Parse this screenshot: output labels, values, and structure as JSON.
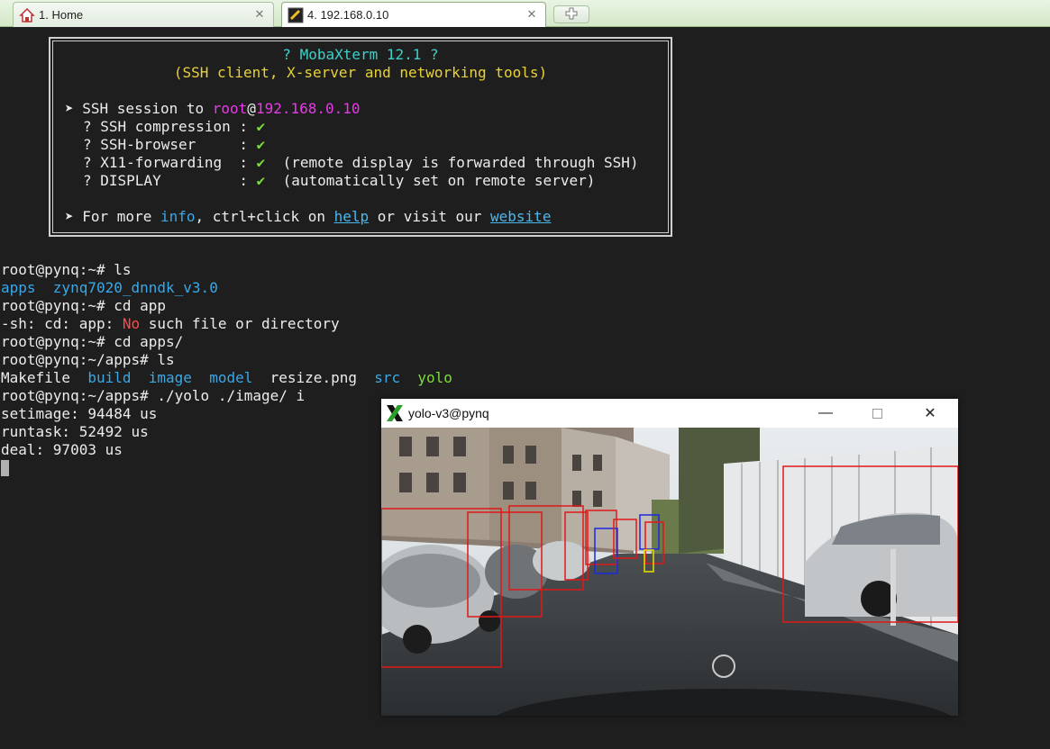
{
  "tabs": [
    {
      "label": "1. Home"
    },
    {
      "label": "4. 192.168.0.10"
    }
  ],
  "banner": {
    "title": "? MobaXterm 12.1 ?",
    "subtitle": "(SSH client, X-server and networking tools)",
    "session_prefix": "➤ SSH session to ",
    "session_user": "root",
    "session_at": "@",
    "session_host": "192.168.0.10",
    "features": [
      {
        "label": "? SSH compression : ",
        "check": "✔",
        "note": ""
      },
      {
        "label": "? SSH-browser     : ",
        "check": "✔",
        "note": ""
      },
      {
        "label": "? X11-forwarding  : ",
        "check": "✔",
        "note": "  (remote display is forwarded through SSH)"
      },
      {
        "label": "? DISPLAY         : ",
        "check": "✔",
        "note": "  (automatically set on remote server)"
      }
    ],
    "more_prefix": "➤ For more ",
    "more_info": "info",
    "more_mid": ", ctrl+click on ",
    "more_help": "help",
    "more_or": " or visit our ",
    "more_website": "website"
  },
  "terminal": {
    "l1": "root@pynq:~# ls",
    "l2_a": "apps",
    "l2_b": "zynq7020_dnndk_v3.0",
    "l3": "root@pynq:~# cd app",
    "l4_a": "-sh: cd: app: ",
    "l4_no": "No",
    "l4_b": " such file or directory",
    "l5": "root@pynq:~# cd apps/",
    "l6": "root@pynq:~/apps# ls",
    "l7_makefile": "Makefile",
    "l7_build": "build",
    "l7_image": "image",
    "l7_model": "model",
    "l7_resize": "resize.png",
    "l7_src": "src",
    "l7_yolo": "yolo",
    "l8": "root@pynq:~/apps# ./yolo ./image/ i",
    "l9": "setimage: 94484 us",
    "l10": "runtask: 52492 us",
    "l11": "deal: 97003 us"
  },
  "xwindow": {
    "title": "yolo-v3@pynq"
  },
  "colors": {
    "box_red": "#e01818",
    "box_blue": "#1a2ae0",
    "box_yellow": "#e8e000"
  }
}
